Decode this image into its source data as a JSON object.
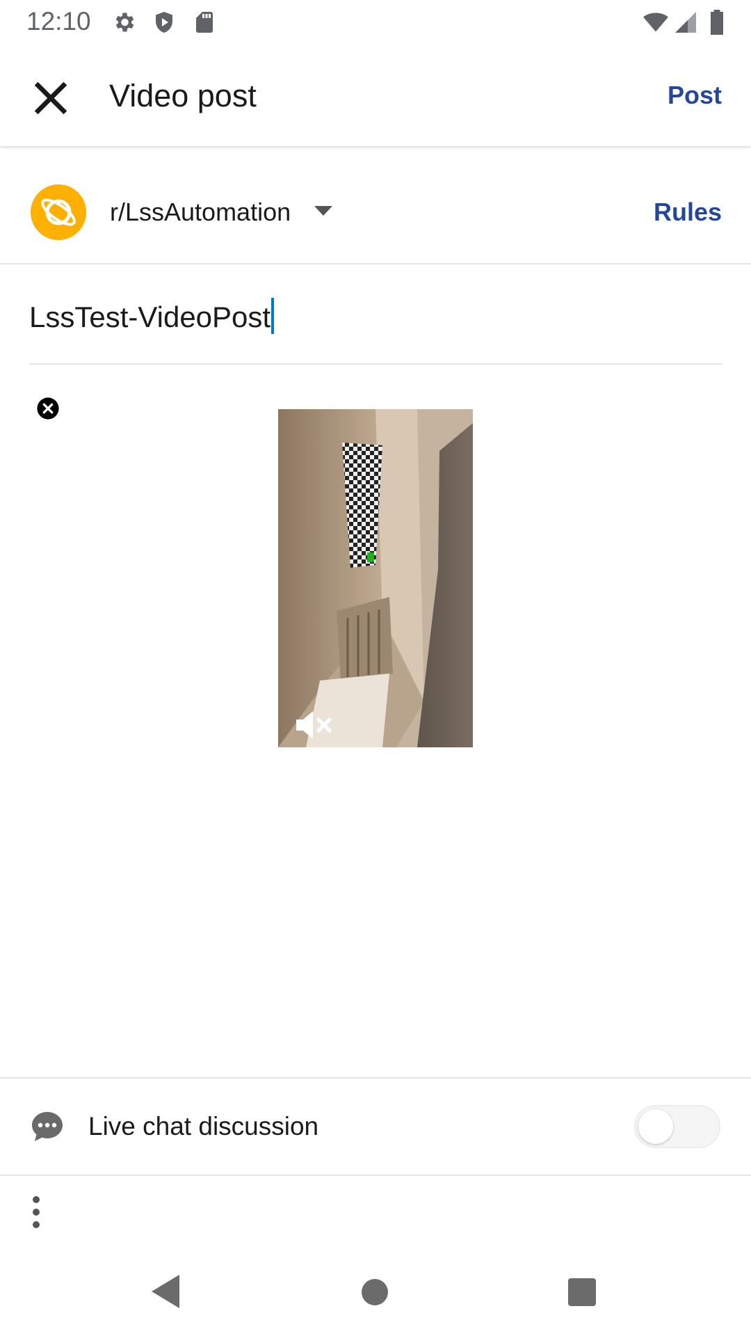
{
  "status_bar": {
    "time": "12:10",
    "left_icons": [
      "settings-icon",
      "shield-icon",
      "sd-card-icon"
    ],
    "right_icons": [
      "wifi-icon",
      "cellular-signal-icon",
      "battery-icon"
    ]
  },
  "app_bar": {
    "close_icon": "close-icon",
    "title": "Video post",
    "post_label": "Post"
  },
  "community": {
    "avatar_icon": "planet-icon",
    "name": "r/LssAutomation",
    "dropdown_icon": "caret-down-icon",
    "rules_label": "Rules"
  },
  "title_input": {
    "value": "LssTest-VideoPost"
  },
  "video": {
    "remove_icon": "close-circle-icon",
    "mute_icon": "volume-off-icon"
  },
  "live_chat": {
    "icon": "chat-bubble-icon",
    "label": "Live chat discussion",
    "toggle_on": false
  },
  "more_icon": "more-vertical-icon",
  "nav_bar": {
    "back_icon": "back-icon",
    "home_icon": "home-icon",
    "recents_icon": "recents-icon"
  },
  "colors": {
    "accent": "#24479b",
    "avatar_bg": "#ffb000",
    "caret": "#0079d3"
  }
}
